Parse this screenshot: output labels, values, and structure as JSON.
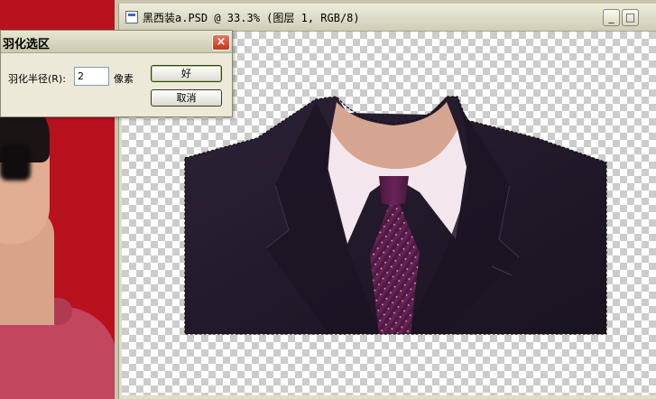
{
  "document_window": {
    "title": "黑西装a.PSD @ 33.3% (图层 1, RGB/8)",
    "minimize_glyph": "_",
    "maximize_glyph": "□"
  },
  "feather_dialog": {
    "title": "羽化选区",
    "close_glyph": "×",
    "radius_label": "羽化半径(R):",
    "radius_value": "2",
    "unit_label": "像素",
    "ok_label": "好",
    "cancel_label": "取消"
  },
  "icons": [
    "photoshop-document-icon",
    "minimize-icon",
    "maximize-icon",
    "close-icon"
  ],
  "colors": {
    "photo_background": "#b8121e",
    "suit": "#241a2c",
    "tie": "#5a1e4a",
    "close_button": "#c6361a"
  }
}
